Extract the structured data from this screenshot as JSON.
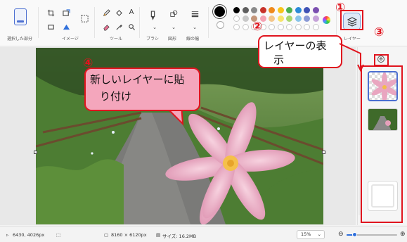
{
  "ribbon": {
    "groups": {
      "selection": "選択した部分",
      "image": "イメージ",
      "tools": "ツール",
      "brushes": "ブラシ",
      "shapes": "図形",
      "size": "線の幅",
      "layers": "レイヤー"
    },
    "tool_icons": [
      "crop-icon",
      "resize-icon",
      "rotate-icon",
      "select-icon",
      "pencil-icon",
      "fill-icon",
      "text-icon",
      "eraser-icon",
      "color-picker-icon",
      "magnifier-icon",
      "brush-icon",
      "shapes-icon",
      "line-width-icon",
      "color-wheel-icon"
    ],
    "palette": [
      "#000000",
      "#5e5e5e",
      "#8a8a8a",
      "#c8322a",
      "#ef8a1c",
      "#f7c51a",
      "#4caf50",
      "#2a8ad8",
      "#3f51b5",
      "#7b4fb0",
      "#ffffff",
      "#c8c8c8",
      "#c4967a",
      "#f5a3b4",
      "#f4c68a",
      "#f8e46b",
      "#a8d670",
      "#88c4ea",
      "#8b9ad6",
      "#c6a3d9"
    ],
    "current_color": "#000000"
  },
  "callouts": {
    "c1": "①",
    "c2_num": "②",
    "c2_text": "レイヤーの表示",
    "c3": "③",
    "c4_num": "④",
    "c4_text": "新しいレイヤーに貼り付け"
  },
  "layers_panel": {
    "add_icon": "⊕",
    "layers": [
      "layer-flower-transparent",
      "layer-path-photo",
      "layer-blank"
    ]
  },
  "status_bar": {
    "cursor_pos": "6430, 4026px",
    "canvas_size": "8160 × 6120px",
    "file_size": "サイズ: 16.2MB",
    "zoom": "15%",
    "zoom_level": 0.15
  },
  "accent": "#e0141e"
}
